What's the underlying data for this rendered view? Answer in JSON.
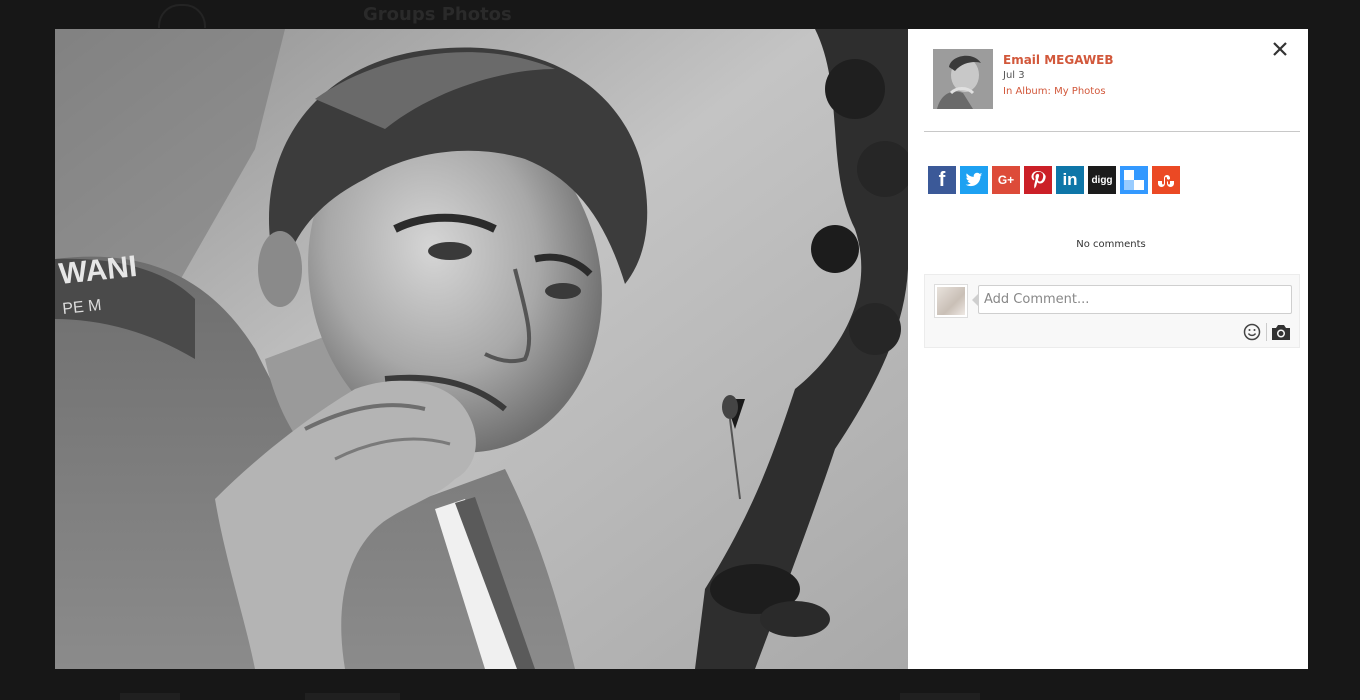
{
  "backdrop": {
    "title": "Groups Photos"
  },
  "photo": {
    "description": "photo"
  },
  "post": {
    "author_name": "Email MEGAWEB",
    "date": "Jul 3",
    "album_prefix": "In Album:",
    "album_name": "My Photos"
  },
  "share": {
    "buttons": [
      {
        "name": "facebook",
        "glyph": "f",
        "color": "#3b5998"
      },
      {
        "name": "twitter",
        "glyph": "twitter-bird-icon",
        "color": "#1da1f2"
      },
      {
        "name": "google-plus",
        "glyph": "G+",
        "color": "#dd4b39"
      },
      {
        "name": "pinterest",
        "glyph": "P",
        "color": "#cb2027"
      },
      {
        "name": "linkedin",
        "glyph": "in",
        "color": "#0e76a8"
      },
      {
        "name": "digg",
        "glyph": "digg",
        "color": "#1b1b1b"
      },
      {
        "name": "delicious",
        "glyph": "delicious-squares-icon",
        "color": "#3399ff"
      },
      {
        "name": "stumbleupon",
        "glyph": "stumbleupon-icon",
        "color": "#eb4924"
      }
    ]
  },
  "comments": {
    "empty_text": "No comments",
    "placeholder": "Add Comment..."
  },
  "icons": {
    "close": "close-icon",
    "emoji": "smiley-icon",
    "camera": "camera-icon"
  }
}
